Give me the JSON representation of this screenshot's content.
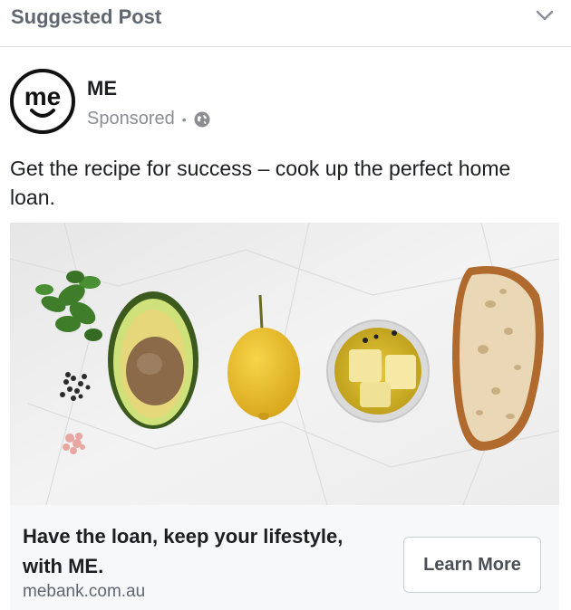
{
  "header": {
    "title": "Suggested Post",
    "menu_icon": "chevron-down-icon"
  },
  "post": {
    "page_name": "ME",
    "logo_text": "me",
    "sponsored_label": "Sponsored",
    "separator": "•",
    "audience_icon": "globe-icon",
    "caption": "Get the recipe for success – cook up the perfect home loan."
  },
  "link_preview": {
    "headline": "Have the loan, keep your lifestyle, with ME.",
    "domain": "mebank.com.au",
    "button_label": "Learn More"
  },
  "colors": {
    "muted_text": "#606770",
    "meta_text": "#8a8d91",
    "preview_bg": "#f7f8fa",
    "button_border": "#ccd0d5"
  }
}
